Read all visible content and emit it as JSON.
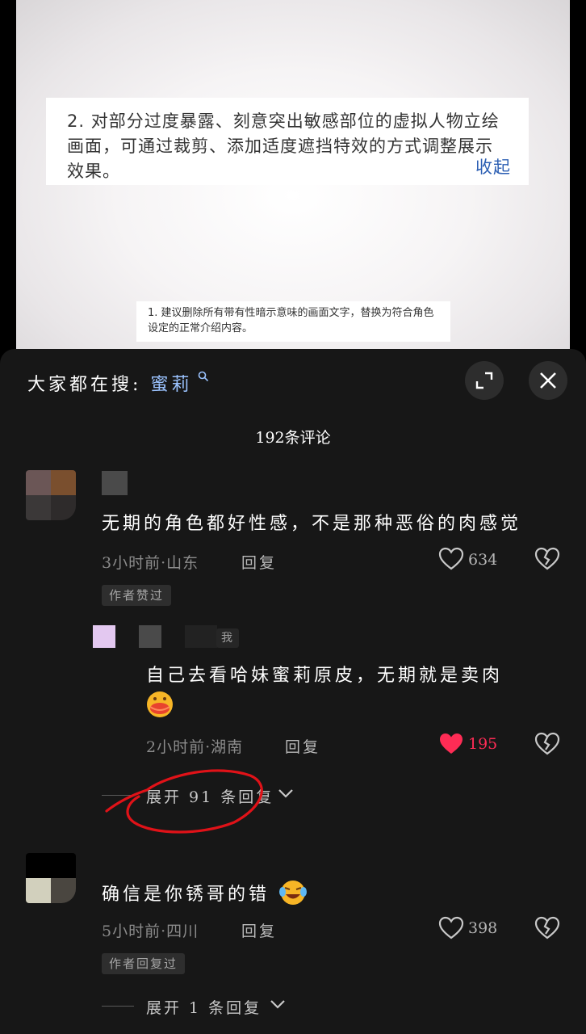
{
  "video": {
    "overlay_text": "2. 对部分过度暴露、刻意突出敏感部位的虚拟人物立绘画面，可通过裁剪、添加适度遮挡特效的方式调整展示效果。",
    "overlay_collapse": "收起",
    "caption_text": "1. 建议删除所有带有性暗示意味的画面文字，替换为符合角色设定的正常介绍内容。"
  },
  "panel": {
    "search_prefix": "大家都在搜:",
    "search_keyword": "蜜莉",
    "comment_count": "192条评论",
    "icons": [
      "search-icon",
      "expand-icon",
      "close-icon",
      "heart-icon",
      "broken-heart-icon",
      "chevron-down-icon"
    ],
    "colors": {
      "panel_bg": "#171717",
      "liked": "#fe2c55",
      "keyword": "#9bc3ff"
    }
  },
  "comments": [
    {
      "text": "无期的角色都好性感，不是那种恶俗的肉感觉",
      "meta": "3小时前·山东",
      "reply": "回复",
      "likes": "634",
      "badge": "作者赞过",
      "liked": false
    },
    {
      "is_reply": true,
      "me_tag": "我",
      "text_line1": "自己去看哈妹蜜莉原皮，无期就是卖肉",
      "meta": "2小时前·湖南",
      "reply": "回复",
      "likes": "195",
      "liked": true,
      "expand": "展开 91 条回复"
    },
    {
      "text": "确信是你锈哥的错",
      "meta": "5小时前·四川",
      "reply": "回复",
      "likes": "398",
      "badge": "作者回复过",
      "liked": false,
      "expand": "展开 1 条回复"
    }
  ]
}
